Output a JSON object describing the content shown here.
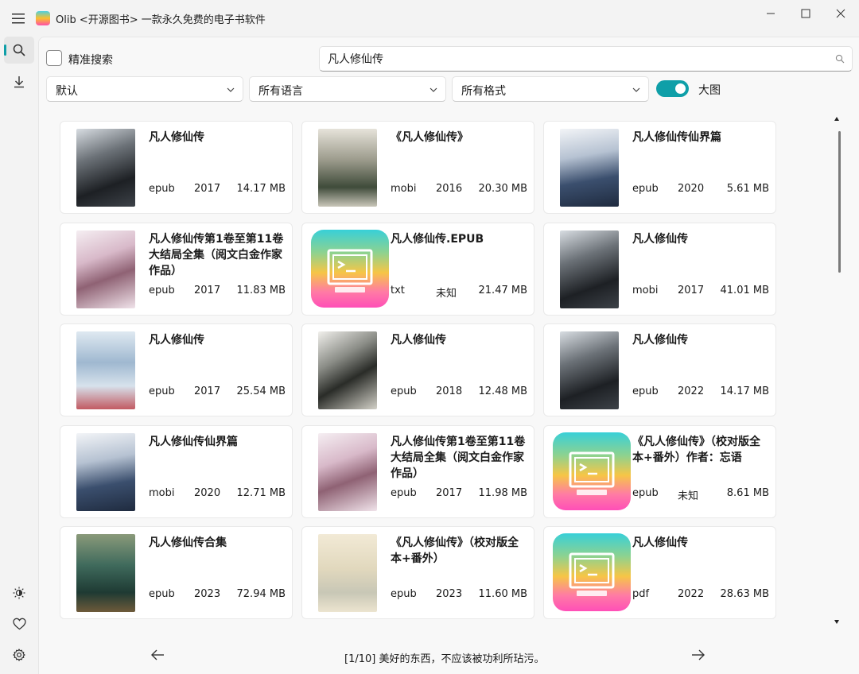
{
  "window": {
    "title": "Olib <开源图书> 一款永久免费的电子书软件"
  },
  "sidebar": {
    "items": [
      {
        "name": "search",
        "icon": "search-icon"
      },
      {
        "name": "download",
        "icon": "download-icon"
      },
      {
        "name": "theme",
        "icon": "brightness-icon"
      },
      {
        "name": "favorites",
        "icon": "heart-icon"
      },
      {
        "name": "settings",
        "icon": "gear-icon"
      }
    ]
  },
  "search": {
    "precise_label": "精准搜索",
    "value": "凡人修仙传",
    "placeholder": ""
  },
  "filters": {
    "sort": "默认",
    "language": "所有语言",
    "format": "所有格式",
    "big_image_label": "大图",
    "big_image_on": true
  },
  "books": [
    {
      "title": "凡人修仙传",
      "format": "epub",
      "year": "2017",
      "size": "14.17 MB",
      "cover": "dark"
    },
    {
      "title": "《凡人修仙传》",
      "format": "mobi",
      "year": "2016",
      "size": "20.30 MB",
      "cover": "hero"
    },
    {
      "title": "凡人修仙传仙界篇",
      "format": "epub",
      "year": "2020",
      "size": "5.61 MB",
      "cover": "blue"
    },
    {
      "title": "凡人修仙传第1卷至第11卷大结局全集（阅文白金作家作品）",
      "format": "epub",
      "year": "2017",
      "size": "11.83 MB",
      "cover": "pink"
    },
    {
      "title": "凡人修仙传.EPUB",
      "format": "txt",
      "year": "未知",
      "size": "21.47 MB",
      "cover": "app"
    },
    {
      "title": "凡人修仙传",
      "format": "mobi",
      "year": "2017",
      "size": "41.01 MB",
      "cover": "dark"
    },
    {
      "title": "凡人修仙传",
      "format": "epub",
      "year": "2017",
      "size": "25.54 MB",
      "cover": "sky"
    },
    {
      "title": "凡人修仙传",
      "format": "epub",
      "year": "2018",
      "size": "12.48 MB",
      "cover": "mist"
    },
    {
      "title": "凡人修仙传",
      "format": "epub",
      "year": "2022",
      "size": "14.17 MB",
      "cover": "dark"
    },
    {
      "title": "凡人修仙传仙界篇",
      "format": "mobi",
      "year": "2020",
      "size": "12.71 MB",
      "cover": "blue"
    },
    {
      "title": "凡人修仙传第1卷至第11卷大结局全集（阅文白金作家作品）",
      "format": "epub",
      "year": "2017",
      "size": "11.98 MB",
      "cover": "pink"
    },
    {
      "title": "《凡人修仙传》（校对版全本+番外）作者：忘语",
      "format": "epub",
      "year": "未知",
      "size": "8.61 MB",
      "cover": "app"
    },
    {
      "title": "凡人修仙传合集",
      "format": "epub",
      "year": "2023",
      "size": "72.94 MB",
      "cover": "green"
    },
    {
      "title": "《凡人修仙传》（校对版全本+番外）",
      "format": "epub",
      "year": "2023",
      "size": "11.60 MB",
      "cover": "paper"
    },
    {
      "title": "凡人修仙传",
      "format": "pdf",
      "year": "2022",
      "size": "28.63 MB",
      "cover": "app"
    }
  ],
  "pagination": {
    "text": "[1/10] 美好的东西，不应该被功利所玷污。"
  },
  "colors": {
    "accent": "#0f9fa8"
  }
}
